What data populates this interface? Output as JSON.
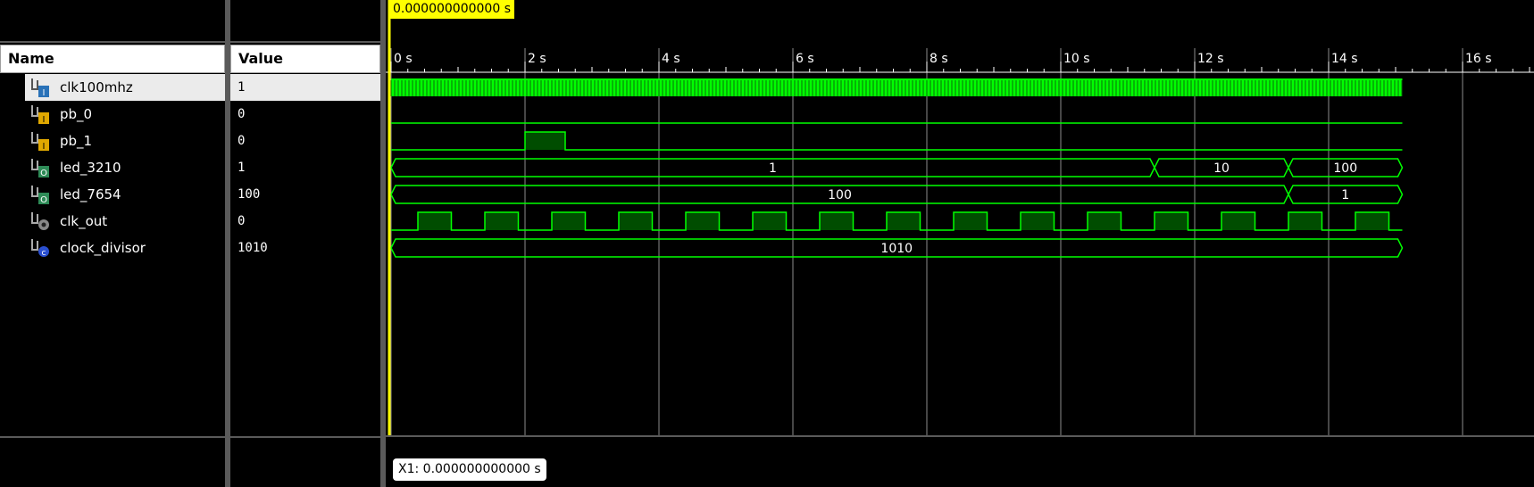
{
  "name_panel": {
    "header": "Name"
  },
  "value_panel": {
    "header": "Value"
  },
  "signals": [
    {
      "name": "clk100mhz",
      "value": "1",
      "icon": "input-bit-icon"
    },
    {
      "name": "pb_0",
      "value": "0",
      "icon": "input-bit-icon"
    },
    {
      "name": "pb_1",
      "value": "0",
      "icon": "input-bit-icon"
    },
    {
      "name": "led_3210",
      "value": "1",
      "icon": "output-bus-icon"
    },
    {
      "name": "led_7654",
      "value": "100",
      "icon": "output-bus-icon"
    },
    {
      "name": "clk_out",
      "value": "0",
      "icon": "output-bit-icon"
    },
    {
      "name": "clock_divisor",
      "value": "1010",
      "icon": "constant-bus-icon"
    }
  ],
  "timeline": {
    "tick_labels": [
      "0 s",
      "2 s",
      "4 s",
      "6 s",
      "8 s",
      "10 s",
      "12 s",
      "14 s",
      "16 s"
    ],
    "ticks": [
      0,
      2,
      4,
      6,
      8,
      10,
      12,
      14,
      16
    ],
    "end_time": 15.1
  },
  "waves": {
    "pb_1_pulses": [
      [
        2,
        2.6
      ]
    ],
    "clk_out_period": 1,
    "clk_out_first_rise": 0.4,
    "led_3210_segments": [
      {
        "start": 0,
        "end": 11.4,
        "label": "1"
      },
      {
        "start": 11.4,
        "end": 13.4,
        "label": "10"
      },
      {
        "start": 13.4,
        "end": 15.1,
        "label": "100"
      }
    ],
    "led_7654_segments": [
      {
        "start": 0,
        "end": 13.4,
        "label": "100"
      },
      {
        "start": 13.4,
        "end": 15.1,
        "label": "1"
      }
    ],
    "clock_divisor_segments": [
      {
        "start": 0,
        "end": 15.1,
        "label": "1010"
      }
    ]
  },
  "cursor": {
    "time_label": "0.000000000000 s",
    "x1_label": "X1: 0.000000000000 s"
  },
  "colors": {
    "wave": "#00ff00",
    "grid": "#8c8c8c",
    "cursor": "#ffff00",
    "pulse_fill": "#004d00"
  }
}
